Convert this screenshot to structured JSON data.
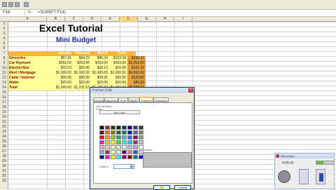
{
  "formula_bar": {
    "name_box": "F16",
    "fx": "fx",
    "formula": "=SUM(F7:F14)"
  },
  "columns": [
    "A",
    "B",
    "C",
    "D",
    "E",
    "F",
    "G",
    "H",
    "I"
  ],
  "selected_column": "F",
  "rows": [
    "1",
    "2",
    "3",
    "4",
    "5",
    "6",
    "7",
    "8",
    "9",
    "10",
    "11",
    "12",
    "13",
    "14",
    "15",
    "16",
    "17",
    "18",
    "19",
    "20",
    "21",
    "22",
    "23",
    "24",
    "25",
    "26",
    "27",
    "28",
    "29",
    "30",
    "31",
    "32",
    "33"
  ],
  "sheet": {
    "title": "Excel Tutorial",
    "subtitle": "Mini Budget"
  },
  "table": {
    "header": [
      "",
      "January",
      "February",
      "March",
      "Total"
    ],
    "rows": [
      {
        "label": "Groceries",
        "values": [
          "$57.41",
          "$64.22",
          "$46.34",
          "$122.34",
          "$290.31"
        ]
      },
      {
        "label": "Car Payment",
        "values": [
          "$263.00",
          "$263.00",
          "$263.00",
          "$263.00",
          "$1,052.00"
        ]
      },
      {
        "label": "Electric/Gas",
        "values": [
          "$23.53",
          "$33.46",
          "$28.13",
          "$15.98",
          "$101.10"
        ]
      },
      {
        "label": "Rent / Mortgage",
        "values": [
          "$1,000.00",
          "$1,000.00",
          "$1,000.00",
          "$1,000.00",
          "$4,000.00"
        ]
      },
      {
        "label": "Cable / Internet",
        "values": [
          "$39.95",
          "$39.95",
          "$39.95",
          "$39.95",
          "$159.80"
        ]
      },
      {
        "label": "Water",
        "values": [
          "$20.00",
          "$20.00",
          "$20.00",
          "$20.00",
          "$80.00"
        ]
      },
      {
        "label": "Total",
        "values": [
          "$1,266.00",
          "$1,231.67",
          "$1,397.42",
          "$1,461.27",
          "$5,683.21"
        ]
      }
    ]
  },
  "dialog": {
    "title": "Format Cells",
    "tabs": [
      "Number",
      "Alignment",
      "Font",
      "Border",
      "Patterns",
      "Protection"
    ],
    "active_tab": "Patterns",
    "shading_label": "Cell shading",
    "color_label": "Color:",
    "no_color": "No Color",
    "sample_label": "Sample",
    "pattern_label": "Pattern:",
    "ok": "OK",
    "cancel": "Cancel",
    "palette": [
      "#000000",
      "#993300",
      "#333300",
      "#003300",
      "#003366",
      "#000080",
      "#333399",
      "#333333",
      "#800000",
      "#ff6600",
      "#808000",
      "#008000",
      "#008080",
      "#0000ff",
      "#666699",
      "#808080",
      "#ff0000",
      "#ff9900",
      "#99cc00",
      "#339966",
      "#33cccc",
      "#3366ff",
      "#800080",
      "#969696",
      "#ff00ff",
      "#ffcc00",
      "#ffff00",
      "#00ff00",
      "#00ffff",
      "#00ccff",
      "#993366",
      "#c0c0c0",
      "#ff99cc",
      "#ffcc99",
      "#ffff99",
      "#ccffcc",
      "#ccffff",
      "#99ccff",
      "#cc99ff",
      "#ffffff",
      "#9999ff",
      "#993366",
      "#ffffcc",
      "#ccffff",
      "#660066",
      "#ff8080",
      "#0066cc",
      "#ccccff",
      "#000080",
      "#ff00ff",
      "#ffff00",
      "#00ffff",
      "#800080",
      "#800000",
      "#008080",
      "#0000ff"
    ],
    "sample_color": "#c0c0c0"
  },
  "recorder": {
    "title": "Recording...",
    "time": "0:06:55",
    "progress": 0.4
  }
}
